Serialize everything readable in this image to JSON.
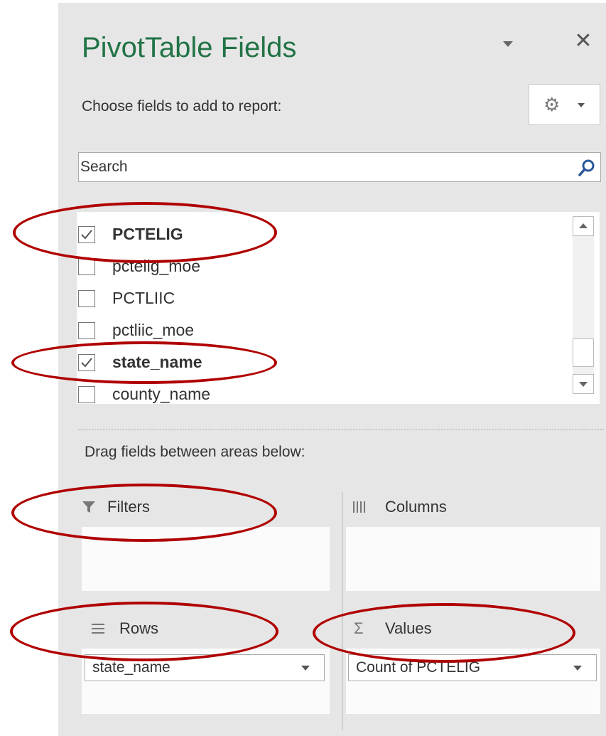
{
  "panel": {
    "title": "PivotTable Fields",
    "choose_label": "Choose fields to add to report:",
    "accent_color": "#217346"
  },
  "search": {
    "placeholder": "Search",
    "value": ""
  },
  "fields": [
    {
      "label": "PCTELIG",
      "checked": true
    },
    {
      "label": "pctelig_moe",
      "checked": false
    },
    {
      "label": "PCTLIIC",
      "checked": false
    },
    {
      "label": "pctliic_moe",
      "checked": false
    },
    {
      "label": "state_name",
      "checked": true
    },
    {
      "label": "county_name",
      "checked": false
    }
  ],
  "areas": {
    "drag_label": "Drag fields between areas below:",
    "filters": {
      "label": "Filters"
    },
    "columns": {
      "label": "Columns"
    },
    "rows": {
      "label": "Rows",
      "items": [
        "state_name"
      ]
    },
    "values": {
      "label": "Values",
      "items": [
        "Count of PCTELIG"
      ]
    }
  },
  "annotation_color": "#b00000"
}
